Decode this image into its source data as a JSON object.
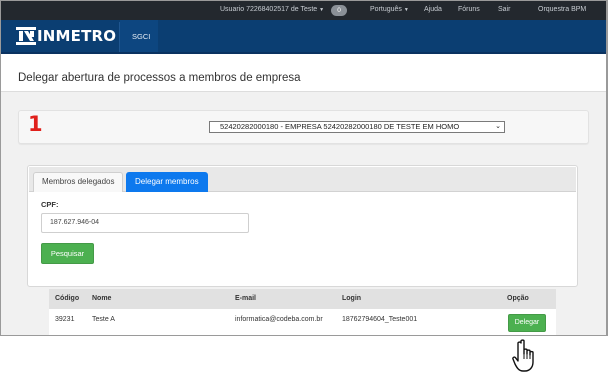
{
  "topbar": {
    "user": "Usuario 72268402517 de Teste",
    "notifications": "0",
    "language": "Português",
    "help": "Ajuda",
    "forums": "Fóruns",
    "logout": "Sair",
    "orchestra": "Orquestra BPM"
  },
  "brand": {
    "logo_text": "INMETRO",
    "system": "SGCI"
  },
  "page": {
    "title": "Delegar abertura de processos a membros de empresa"
  },
  "company": {
    "step": "1",
    "selected": "52420282000180 - EMPRESA 52420282000180 DE TESTE EM HOMO"
  },
  "tabs": [
    {
      "label": "Membros delegados",
      "active": false
    },
    {
      "label": "Delegar membros",
      "active": true
    }
  ],
  "form": {
    "cpf_label": "CPF:",
    "cpf_value": "187.627.946-04",
    "search_label": "Pesquisar"
  },
  "table": {
    "headers": [
      "Código",
      "Nome",
      "E-mail",
      "Login",
      "Opção"
    ],
    "rows": [
      {
        "code": "39231",
        "name": "Teste A",
        "email": "informatica@codeba.com.br",
        "login": "18762794604_Teste001",
        "action": "Delegar"
      }
    ]
  },
  "colors": {
    "brand_blue": "#0b3e72",
    "active_tab": "#0d79ee",
    "success_green": "#4cb050",
    "step_red": "#e0201b"
  },
  "icons": [
    "caret-down-icon",
    "inmetro-logo-icon",
    "hand-pointer-icon"
  ]
}
